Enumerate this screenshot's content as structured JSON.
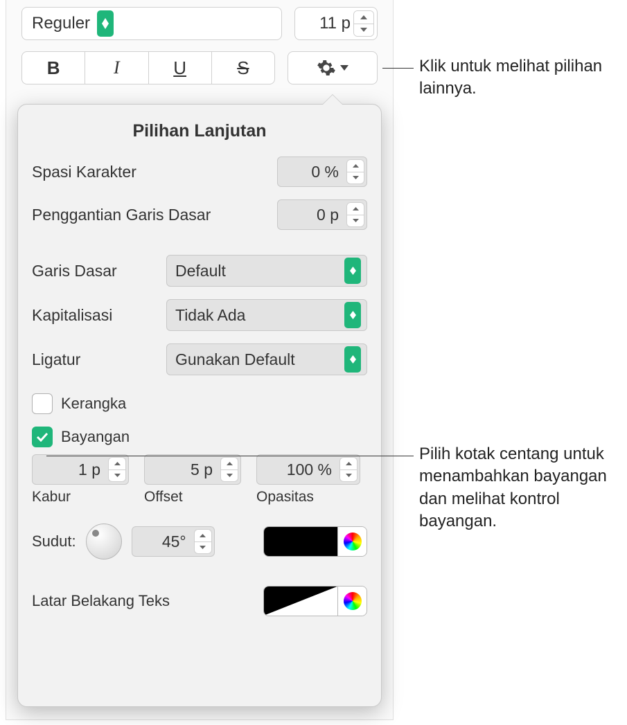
{
  "toolbar": {
    "font_style": "Reguler",
    "font_size": "11 p",
    "bold": "B",
    "italic": "I",
    "underline": "U",
    "strike": "S"
  },
  "popover": {
    "title": "Pilihan Lanjutan",
    "char_spacing_label": "Spasi Karakter",
    "char_spacing_value": "0 %",
    "baseline_shift_label": "Penggantian Garis Dasar",
    "baseline_shift_value": "0 p",
    "baseline_label": "Garis Dasar",
    "baseline_value": "Default",
    "caps_label": "Kapitalisasi",
    "caps_value": "Tidak Ada",
    "ligature_label": "Ligatur",
    "ligature_value": "Gunakan Default",
    "outline_label": "Kerangka",
    "shadow_label": "Bayangan",
    "blur_value": "1 p",
    "blur_label": "Kabur",
    "offset_value": "5 p",
    "offset_label": "Offset",
    "opacity_value": "100 %",
    "opacity_label": "Opasitas",
    "angle_label": "Sudut:",
    "angle_value": "45°",
    "shadow_color": "#000000",
    "textbg_label": "Latar Belakang Teks"
  },
  "callouts": {
    "gear": "Klik untuk melihat pilihan lainnya.",
    "shadow": "Pilih kotak centang untuk menambahkan bayangan dan melihat kontrol bayangan."
  },
  "colors": {
    "accent": "#1fb67a"
  }
}
